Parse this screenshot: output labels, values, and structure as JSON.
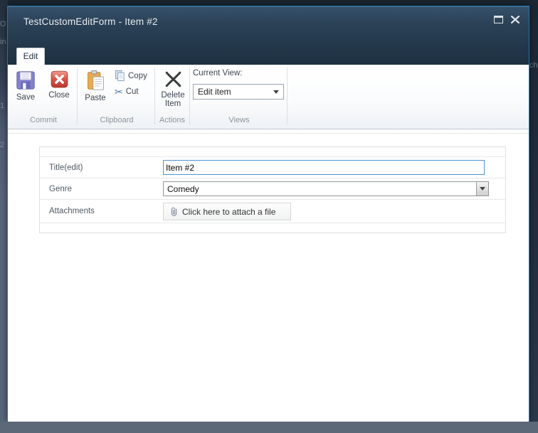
{
  "window": {
    "title": "TestCustomEditForm - Item #2"
  },
  "ribbon": {
    "tab_label": "Edit",
    "groups": {
      "commit": {
        "label": "Commit",
        "save": "Save",
        "close": "Close"
      },
      "clipboard": {
        "label": "Clipboard",
        "paste": "Paste",
        "copy": "Copy",
        "cut": "Cut"
      },
      "actions": {
        "label": "Actions",
        "delete_item": "Delete Item"
      },
      "views": {
        "label": "Views",
        "current_view_label": "Current View:",
        "current_view_value": "Edit item"
      }
    }
  },
  "form": {
    "title_label": "Title(edit)",
    "title_value": "Item #2",
    "genre_label": "Genre",
    "genre_value": "Comedy",
    "attachments_label": "Attachments",
    "attach_button_label": "Click here to attach a file"
  },
  "background_fragments": {
    "left_a": "O",
    "left_b": "in",
    "left_num_1": "1",
    "left_num_2": "2",
    "right_a": "ch"
  },
  "icons": {
    "cut_glyph": "✂"
  },
  "colors": {
    "titlebar": "#2b4257",
    "dialog_border": "#1d78b5",
    "focused_input_border": "#4f94cd"
  }
}
